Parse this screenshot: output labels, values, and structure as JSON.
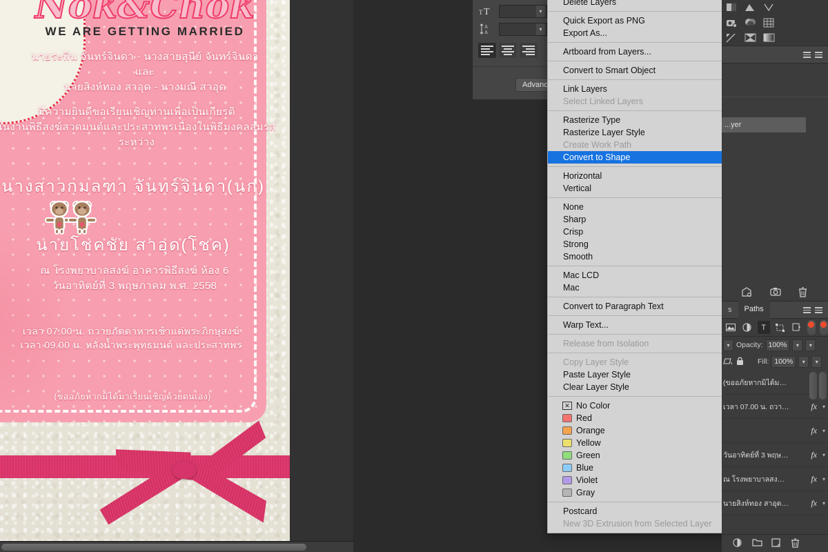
{
  "app": {
    "name": "Adobe Photoshop"
  },
  "canvas": {
    "document": {
      "title_script": "Nok&Chok",
      "subtitle_en": "WE ARE GETTING MARRIED",
      "parents": [
        "นายระพิน จันทร์จินดา - นางสายสุนีย์ จันทร์จินดา",
        "และ",
        "นายสิงห์ทอง  สาอุด - นางมณี  สาอุด"
      ],
      "invite_lines": [
        "มีความยินดีขอเรียนเชิญท่านเพื่อเป็นเกียรติ",
        "ในงานพิธีสงฆ์สวดมนต์และประสาทพรเนื่องในพิธีมงคลสมรส",
        "ระหว่าง"
      ],
      "bride": "นางสาวกมลฑา จันทร์จินดา(นก)",
      "groom": "นายโชคชัย สาอุด(โชค)",
      "bears_icon": "two-teddy-bears",
      "venue_lines": [
        "ณ โรงพยาบาลสงฆ์ อาคารพิธีสงฆ์ ห้อง 6",
        "วันอาทิตย์ที่ 3 พฤษภาคม  พ.ศ.  2558"
      ],
      "schedule_lines": [
        "เวลา 07.00 น.   ถวายภัตตาหารเช้าแด่พระภิกษุสงฆ์",
        "เวลา 09.00 น.   หลั่งน้ำพระพุทธมนต์ และประสาทพร"
      ],
      "apology": "(ขออภัยหากมิได้มาเรียนเชิญด้วยตนเอง)",
      "ribbon_color": "#e03a6d",
      "card_color": "#f79fb0"
    }
  },
  "character_panel": {
    "font_size": {
      "icon": "font-size-icon",
      "value": "",
      "placeholder": ""
    },
    "leading": {
      "icon": "leading-icon",
      "value": "",
      "placeholder": ""
    },
    "alignment": [
      {
        "name": "align-left",
        "label": "Left align text",
        "active": true
      },
      {
        "name": "align-center",
        "label": "Center text",
        "active": false
      },
      {
        "name": "align-right",
        "label": "Right align text",
        "active": false
      }
    ],
    "advanced_label": "Advanced"
  },
  "context_menu": {
    "items": [
      {
        "label": "Delete Layers",
        "state": "clipped"
      },
      {
        "type": "separator"
      },
      {
        "label": "Quick Export as PNG",
        "state": "normal"
      },
      {
        "label": "Export As...",
        "state": "normal"
      },
      {
        "type": "separator"
      },
      {
        "label": "Artboard from Layers...",
        "state": "normal"
      },
      {
        "type": "separator"
      },
      {
        "label": "Convert to Smart Object",
        "state": "normal"
      },
      {
        "type": "separator"
      },
      {
        "label": "Link Layers",
        "state": "normal"
      },
      {
        "label": "Select Linked Layers",
        "state": "disabled"
      },
      {
        "type": "separator"
      },
      {
        "label": "Rasterize Type",
        "state": "normal"
      },
      {
        "label": "Rasterize Layer Style",
        "state": "normal"
      },
      {
        "label": "Create Work Path",
        "state": "disabled"
      },
      {
        "label": "Convert to Shape",
        "state": "selected"
      },
      {
        "type": "separator"
      },
      {
        "label": "Horizontal",
        "state": "normal"
      },
      {
        "label": "Vertical",
        "state": "normal"
      },
      {
        "type": "separator"
      },
      {
        "label": "None",
        "state": "normal"
      },
      {
        "label": "Sharp",
        "state": "normal"
      },
      {
        "label": "Crisp",
        "state": "normal"
      },
      {
        "label": "Strong",
        "state": "normal"
      },
      {
        "label": "Smooth",
        "state": "normal"
      },
      {
        "type": "separator"
      },
      {
        "label": "Mac LCD",
        "state": "normal"
      },
      {
        "label": "Mac",
        "state": "normal"
      },
      {
        "type": "separator"
      },
      {
        "label": "Convert to Paragraph Text",
        "state": "normal"
      },
      {
        "type": "separator"
      },
      {
        "label": "Warp Text...",
        "state": "normal"
      },
      {
        "type": "separator"
      },
      {
        "label": "Release from Isolation",
        "state": "disabled"
      },
      {
        "type": "separator"
      },
      {
        "label": "Copy Layer Style",
        "state": "disabled"
      },
      {
        "label": "Paste Layer Style",
        "state": "normal"
      },
      {
        "label": "Clear Layer Style",
        "state": "normal"
      },
      {
        "type": "separator"
      },
      {
        "label": "No Color",
        "state": "normal",
        "swatch": "none"
      },
      {
        "label": "Red",
        "state": "normal",
        "swatch": "#f4736e"
      },
      {
        "label": "Orange",
        "state": "normal",
        "swatch": "#f5a councils"
      },
      {
        "label": "Yellow",
        "state": "normal",
        "swatch": "#ede06a"
      },
      {
        "label": "Green",
        "state": "normal",
        "swatch": "#90dd7c"
      },
      {
        "label": "Blue",
        "state": "normal",
        "swatch": "#8ccbf7"
      },
      {
        "label": "Violet",
        "state": "normal",
        "swatch": "#b39ae8"
      },
      {
        "label": "Gray",
        "state": "normal",
        "swatch": "#b5b5b5"
      },
      {
        "type": "separator"
      },
      {
        "label": "Postcard",
        "state": "normal"
      },
      {
        "label": "New 3D Extrusion from Selected Layer",
        "state": "disabled"
      }
    ],
    "selected_label": "Convert to Shape",
    "highlight_color": "#1673e0"
  },
  "right_dock": {
    "partial_layer_label": "...yer",
    "panel_tabs": [
      {
        "label": "s",
        "active": false
      },
      {
        "label": "Paths",
        "active": true
      }
    ],
    "filter_icons": [
      "pixel-filter-icon",
      "adjustment-filter-icon",
      "type-filter-icon",
      "shape-filter-icon",
      "smart-object-filter-icon"
    ],
    "blend_opacity": {
      "label": "Opacity:",
      "value": "100%"
    },
    "fill": {
      "label": "Fill:",
      "value": "100%"
    },
    "lock_icons": [
      "lock-transparent-icon",
      "lock-image-icon",
      "lock-position-icon",
      "lock-all-icon"
    ],
    "layers": [
      {
        "name": "(ขออภัยหากมิได้มาเรียนเชิ...",
        "has_fx": true
      },
      {
        "name": "เวลา 07.00 น.  ถวายภัต...",
        "has_fx": true
      },
      {
        "name": "",
        "has_fx": true
      },
      {
        "name": "วันอาทิตย์ที่ 3 พฤษภาคม ...",
        "has_fx": true
      },
      {
        "name": "ณ โรงพยาบาลสงฆ์ อาคาร...",
        "has_fx": true
      },
      {
        "name": "นายสิงห์ทอง สาอุด - นางม...",
        "has_fx": true
      }
    ],
    "bottom_icons": [
      "link-layers-icon",
      "layer-style-icon",
      "layer-mask-icon",
      "adjustment-layer-icon",
      "new-group-icon",
      "new-layer-icon",
      "delete-layer-icon"
    ],
    "mid_icons": [
      "new-layer-icon",
      "snapshot-icon",
      "trash-icon"
    ]
  },
  "scrollbar": {
    "orientation": "horizontal"
  }
}
